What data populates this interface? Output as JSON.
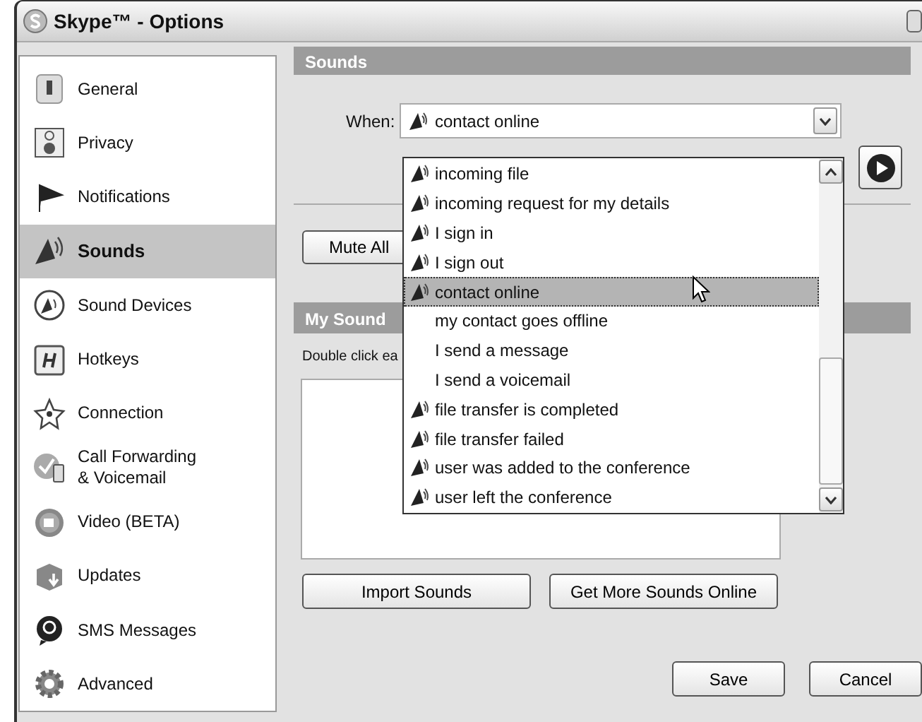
{
  "window": {
    "title": "Skype™ - Options"
  },
  "sidebar": {
    "items": [
      {
        "label": "General",
        "selected": false
      },
      {
        "label": "Privacy",
        "selected": false
      },
      {
        "label": "Notifications",
        "selected": false
      },
      {
        "label": "Sounds",
        "selected": true
      },
      {
        "label": "Sound Devices",
        "selected": false
      },
      {
        "label": "Hotkeys",
        "selected": false
      },
      {
        "label": "Connection",
        "selected": false
      },
      {
        "label": "Call Forwarding\n& Voicemail",
        "selected": false
      },
      {
        "label": "Video (BETA)",
        "selected": false
      },
      {
        "label": "Updates",
        "selected": false
      },
      {
        "label": "SMS Messages",
        "selected": false
      },
      {
        "label": "Advanced",
        "selected": false
      }
    ]
  },
  "sounds_section": {
    "title": "Sounds",
    "when_label": "When:",
    "when_value": "contact online",
    "mute_button": "Mute All"
  },
  "my_sounds_section": {
    "title": "My Sound",
    "hint": "Double click ea"
  },
  "library_buttons": [
    "Import Sounds",
    "Get More Sounds Online"
  ],
  "dialog_buttons": [
    "Save",
    "Cancel"
  ],
  "dropdown": {
    "items": [
      {
        "label": "incoming file",
        "has_sound": true,
        "selected": false
      },
      {
        "label": "incoming request for my details",
        "has_sound": true,
        "selected": false
      },
      {
        "label": "I sign in",
        "has_sound": true,
        "selected": false
      },
      {
        "label": "I sign out",
        "has_sound": true,
        "selected": false
      },
      {
        "label": "contact online",
        "has_sound": true,
        "selected": true
      },
      {
        "label": "my contact goes offline",
        "has_sound": false,
        "selected": false
      },
      {
        "label": "I send a message",
        "has_sound": false,
        "selected": false
      },
      {
        "label": "I send a voicemail",
        "has_sound": false,
        "selected": false
      },
      {
        "label": "file transfer is completed",
        "has_sound": true,
        "selected": false
      },
      {
        "label": "file transfer failed",
        "has_sound": true,
        "selected": false
      },
      {
        "label": "user was added to the conference",
        "has_sound": true,
        "selected": false
      },
      {
        "label": "user left the conference",
        "has_sound": true,
        "selected": false
      }
    ]
  }
}
